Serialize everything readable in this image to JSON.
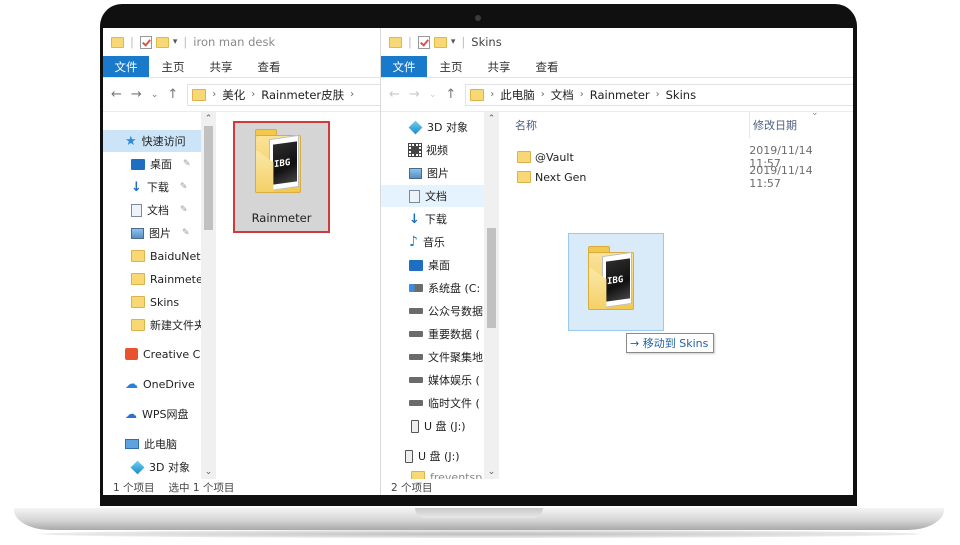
{
  "left_window": {
    "title": "iron man desk",
    "ribbon": {
      "file": "文件",
      "tabs": [
        "主页",
        "共享",
        "查看"
      ]
    },
    "breadcrumb": [
      "美化",
      "Rainmeter皮肤"
    ],
    "nav": {
      "quick_access": "快速访问",
      "items": [
        "桌面",
        "下载",
        "文档",
        "图片",
        "BaiduNet",
        "Rainmeter",
        "Skins",
        "新建文件夹"
      ],
      "creative_cloud": "Creative Cl",
      "onedrive": "OneDrive",
      "wps": "WPS网盘",
      "this_pc": "此电脑",
      "objects3d": "3D 对象"
    },
    "file": {
      "name": "Rainmeter",
      "logo": "IBG"
    },
    "status": {
      "count": "1 个项目",
      "selected": "选中 1 个项目"
    }
  },
  "right_window": {
    "title": "Skins",
    "ribbon": {
      "file": "文件",
      "tabs": [
        "主页",
        "共享",
        "查看"
      ]
    },
    "breadcrumb": [
      "此电脑",
      "文档",
      "Rainmeter",
      "Skins"
    ],
    "nav": {
      "items": [
        "3D 对象",
        "视频",
        "图片",
        "文档",
        "下载",
        "音乐",
        "桌面",
        "系统盘 (C:",
        "公众号数据",
        "重要数据 (",
        "文件聚集地",
        "媒体娱乐 (",
        "临时文件 (",
        "U 盘 (J:)"
      ],
      "usb": "U 盘 (J:)",
      "last": "freventsp"
    },
    "columns": {
      "name": "名称",
      "date": "修改日期"
    },
    "files": [
      {
        "name": "@Vault",
        "date": "2019/11/14 11:57"
      },
      {
        "name": "Next Gen",
        "date": "2019/11/14 11:57"
      }
    ],
    "drag": {
      "logo": "IBG",
      "tooltip": "移动到 Skins"
    },
    "status": {
      "count": "2 个项目"
    }
  }
}
